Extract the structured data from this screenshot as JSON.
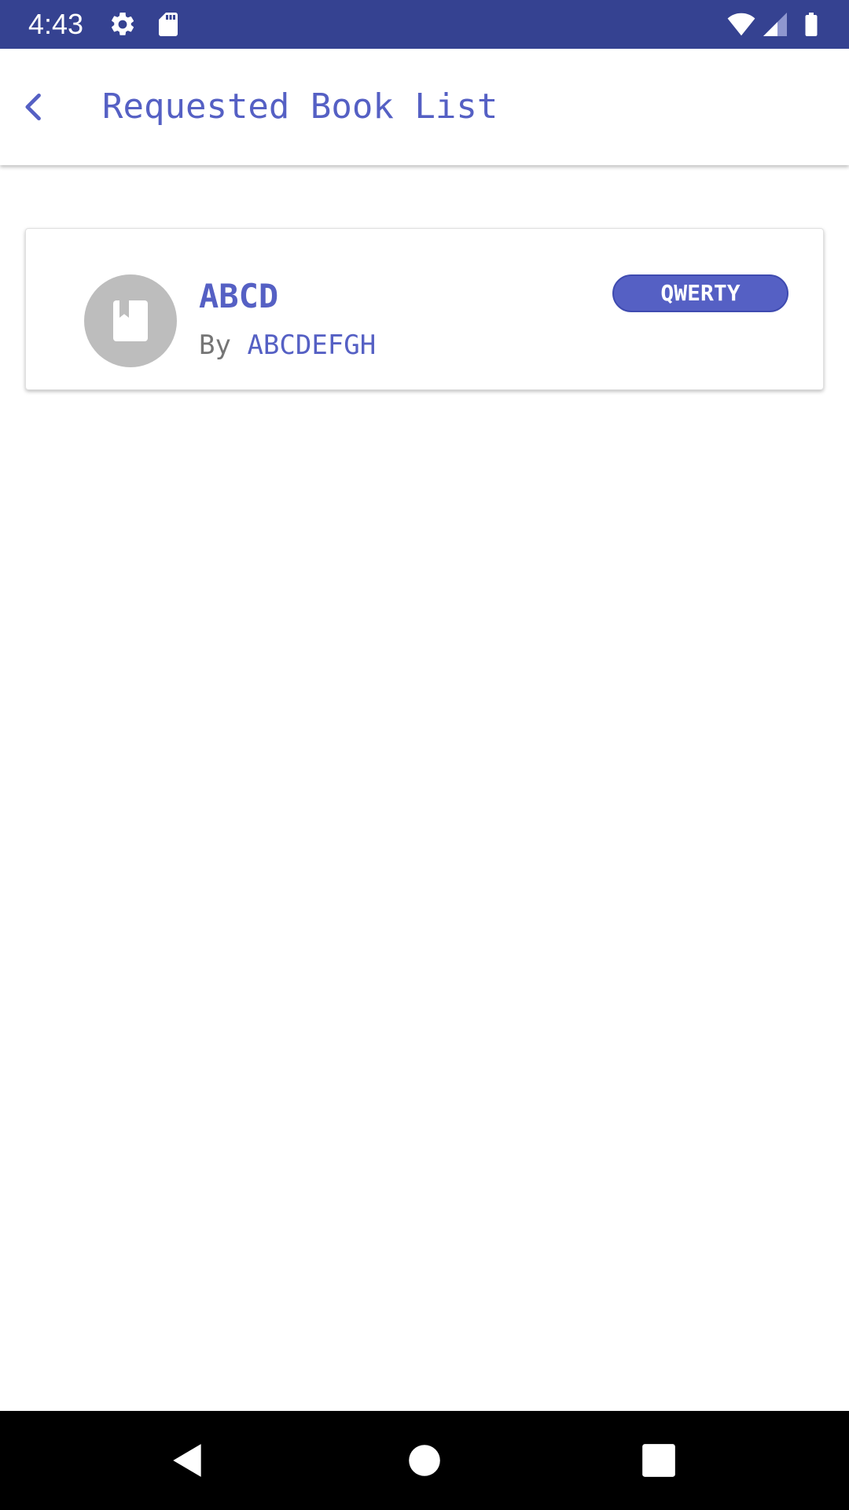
{
  "status_bar": {
    "time": "4:43",
    "background": "#354291",
    "icons": [
      "gear-icon",
      "sd-card-icon",
      "wifi-icon",
      "cellular-signal-icon",
      "battery-icon"
    ]
  },
  "app_bar": {
    "title": "Requested Book List",
    "back_icon": "chevron-left-icon",
    "accent_color": "#5560c4"
  },
  "books": [
    {
      "title": "ABCD",
      "author_prefix": "By",
      "author": "ABCDEFGH",
      "badge": "QWERTY",
      "icon": "book-icon"
    }
  ],
  "nav_bar": {
    "buttons": [
      "back-triangle-icon",
      "home-circle-icon",
      "recents-square-icon"
    ]
  }
}
